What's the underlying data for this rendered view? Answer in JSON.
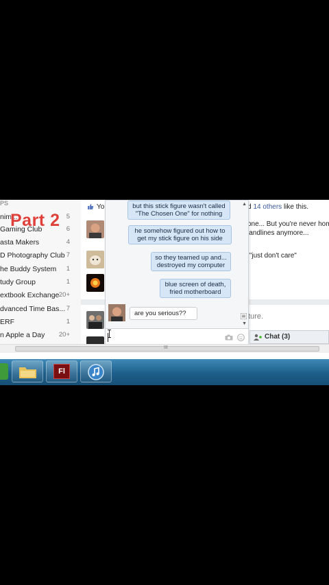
{
  "overlay": {
    "title": "Part 2"
  },
  "sidebar": {
    "header": "PS",
    "groups": [
      {
        "name": "nim...",
        "count": "5"
      },
      {
        "name": "Gaming Club",
        "count": "6"
      },
      {
        "name": "asta Makers",
        "count": "4"
      },
      {
        "name": "D Photography Club",
        "count": "7"
      },
      {
        "name": "he Buddy System",
        "count": "1"
      },
      {
        "name": "tudy Group",
        "count": "1"
      },
      {
        "name": "extbook Exchange",
        "count": "20+"
      },
      {
        "name": "dvanced Time Bas...",
        "count": "7"
      },
      {
        "name": "ERF",
        "count": "1"
      },
      {
        "name": "n Apple a Day",
        "count": "20+"
      }
    ]
  },
  "feed": {
    "like_prefix": "Yo",
    "like_and": "and",
    "like_others": "14 others",
    "like_suffix": "like this.",
    "post1_line1": "one... But you're never hom",
    "post1_line2": "landlines anymore...",
    "post2_text": "\" and \"just don't care\"",
    "post3_text": "ture."
  },
  "chat": {
    "messages": [
      {
        "text": "but this stick figure wasn't called \"The Chosen One\" for nothing"
      },
      {
        "text": "he somehow figured out how to get my stick figure on his side"
      },
      {
        "text": "so they teamed up and... destroyed my computer"
      },
      {
        "text": "blue screen of death, fried motherboard"
      }
    ],
    "reply": "are you serious??"
  },
  "chatbar": {
    "label": "Chat (3)"
  },
  "scrollbar": {
    "grip": "III"
  },
  "taskbar": {
    "flash_label": "Fl"
  },
  "colors": {
    "accent": "#3b5998",
    "bubble": "#d6e6f7",
    "overlay_red": "#e0403a",
    "taskbar": "#1d5e8a"
  }
}
